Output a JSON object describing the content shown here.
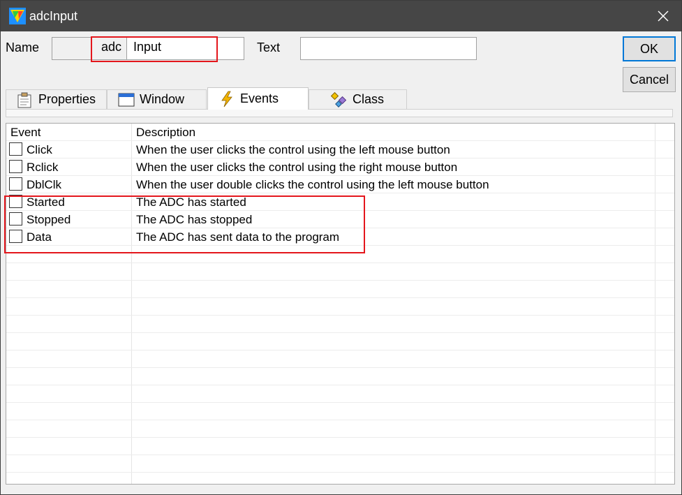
{
  "window": {
    "title": "adcInput"
  },
  "name_section": {
    "label": "Name",
    "prefix": "adc",
    "value": "Input"
  },
  "text_section": {
    "label": "Text",
    "value": ""
  },
  "buttons": {
    "ok": "OK",
    "cancel": "Cancel"
  },
  "tabs": [
    {
      "label": "Properties",
      "icon": "properties-icon"
    },
    {
      "label": "Window",
      "icon": "window-icon"
    },
    {
      "label": "Events",
      "icon": "lightning-icon",
      "active": true
    },
    {
      "label": "Class",
      "icon": "class-icon"
    }
  ],
  "events_table": {
    "headers": [
      "Event",
      "Description"
    ],
    "rows": [
      {
        "event": "Click",
        "description": "When the user clicks the control using the left mouse button",
        "checked": false
      },
      {
        "event": "Rclick",
        "description": "When the user clicks the control using the right mouse button",
        "checked": false
      },
      {
        "event": "DblClk",
        "description": "When the user double clicks the control using the left mouse button",
        "checked": false
      },
      {
        "event": "Started",
        "description": "The ADC has started",
        "checked": false
      },
      {
        "event": "Stopped",
        "description": "The ADC has stopped",
        "checked": false
      },
      {
        "event": "Data",
        "description": "The ADC has sent data to the program",
        "checked": false
      }
    ]
  },
  "colors": {
    "titlebar": "#464646",
    "highlight": "#e4161c",
    "ok_border": "#0078d7"
  }
}
